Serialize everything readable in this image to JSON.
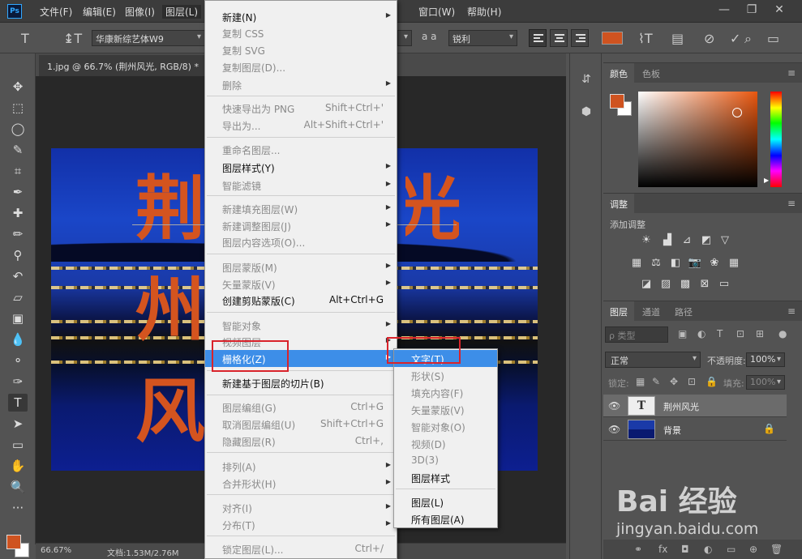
{
  "menubar": {
    "logo": "Ps",
    "items": [
      "文件(F)",
      "编辑(E)",
      "图像(I)",
      "图层(L)",
      "窗口(W)",
      "帮助(H)"
    ],
    "window_controls": [
      "—",
      "❐",
      "✕"
    ]
  },
  "options": {
    "font_family": "华康新综艺体W9",
    "antialias_icon": "a a",
    "antialias": "锐利",
    "text_color": "#cf5320"
  },
  "document": {
    "tab_title": "1.jpg @ 66.7% (荆州风光, RGB/8) *",
    "close": "×",
    "canvas_text": "荆州风光",
    "status_zoom": "66.67%",
    "status_doc": "文档:1.53M/2.76M"
  },
  "panels": {
    "color": {
      "tabs": [
        "颜色",
        "色板"
      ],
      "fg": "#cf5320",
      "bg": "#ffffff"
    },
    "adjustments": {
      "tab": "调整",
      "label": "添加调整"
    },
    "layers": {
      "tabs": [
        "图层",
        "通道",
        "路径"
      ],
      "filter_placeholder": "ρ 类型",
      "blend_mode": "正常",
      "opacity_label": "不透明度:",
      "opacity": "100%",
      "lock_label": "锁定:",
      "fill_label": "填充:",
      "fill": "100%",
      "rows": [
        {
          "name": "荆州风光",
          "thumb": "T"
        },
        {
          "name": "背景"
        }
      ]
    }
  },
  "menu": {
    "items": [
      {
        "label": "新建(N)",
        "arrow": true,
        "disabled": false
      },
      {
        "label": "复制 CSS",
        "disabled": true
      },
      {
        "label": "复制 SVG",
        "disabled": true
      },
      {
        "label": "复制图层(D)...",
        "disabled": true
      },
      {
        "label": "删除",
        "arrow": true,
        "disabled": true
      },
      {
        "label": "快速导出为 PNG",
        "shortcut": "Shift+Ctrl+'",
        "disabled": true
      },
      {
        "label": "导出为...",
        "shortcut": "Alt+Shift+Ctrl+'",
        "disabled": true
      },
      {
        "label": "重命名图层...",
        "disabled": true
      },
      {
        "label": "图层样式(Y)",
        "arrow": true,
        "disabled": false
      },
      {
        "label": "智能滤镜",
        "arrow": true,
        "disabled": true
      },
      {
        "label": "新建填充图层(W)",
        "arrow": true,
        "disabled": true
      },
      {
        "label": "新建调整图层(J)",
        "arrow": true,
        "disabled": true
      },
      {
        "label": "图层内容选项(O)...",
        "disabled": true
      },
      {
        "label": "图层蒙版(M)",
        "arrow": true,
        "disabled": true
      },
      {
        "label": "矢量蒙版(V)",
        "arrow": true,
        "disabled": true
      },
      {
        "label": "创建剪贴蒙版(C)",
        "shortcut": "Alt+Ctrl+G",
        "disabled": false
      },
      {
        "label": "智能对象",
        "arrow": true,
        "disabled": true
      },
      {
        "label": "视频图层",
        "arrow": true,
        "disabled": true
      },
      {
        "label": "栅格化(Z)",
        "arrow": true,
        "disabled": false,
        "highlight": true
      },
      {
        "label": "新建基于图层的切片(B)",
        "disabled": false
      },
      {
        "label": "图层编组(G)",
        "shortcut": "Ctrl+G",
        "disabled": true
      },
      {
        "label": "取消图层编组(U)",
        "shortcut": "Shift+Ctrl+G",
        "disabled": true
      },
      {
        "label": "隐藏图层(R)",
        "shortcut": "Ctrl+,",
        "disabled": true
      },
      {
        "label": "排列(A)",
        "arrow": true,
        "disabled": true
      },
      {
        "label": "合并形状(H)",
        "arrow": true,
        "disabled": true
      },
      {
        "label": "对齐(I)",
        "arrow": true,
        "disabled": true
      },
      {
        "label": "分布(T)",
        "arrow": true,
        "disabled": true
      },
      {
        "label": "锁定图层(L)...",
        "shortcut": "Ctrl+/",
        "disabled": true
      }
    ],
    "submenu": [
      {
        "label": "文字(T)",
        "highlight": true
      },
      {
        "label": "形状(S)",
        "disabled": true
      },
      {
        "label": "填充内容(F)",
        "disabled": true
      },
      {
        "label": "矢量蒙版(V)",
        "disabled": true
      },
      {
        "label": "智能对象(O)",
        "disabled": true
      },
      {
        "label": "视频(D)",
        "disabled": true
      },
      {
        "label": "3D(3)",
        "disabled": true
      },
      {
        "label": "图层样式"
      },
      {
        "label": "图层(L)"
      },
      {
        "label": "所有图层(A)"
      }
    ]
  },
  "watermark": {
    "logo": "Bai 经验",
    "url": "jingyan.baidu.com"
  },
  "colors": {
    "accent_red": "#d9232b",
    "highlight": "#3d8ee8",
    "text_orange": "#cf5320"
  }
}
